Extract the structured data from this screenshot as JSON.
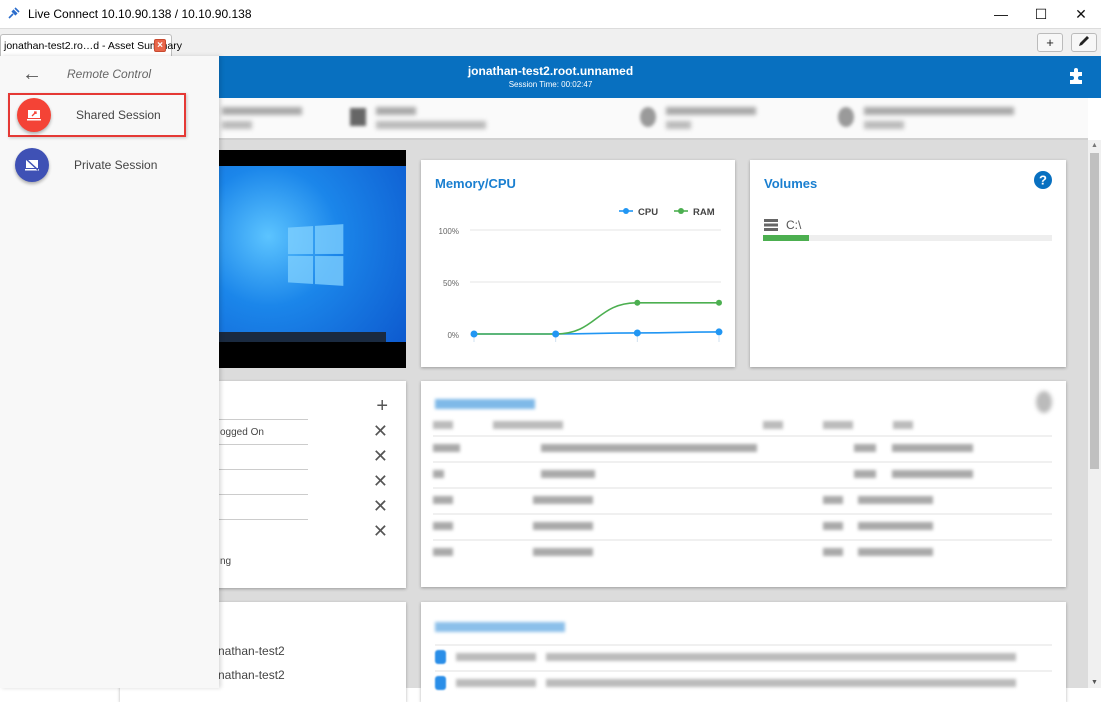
{
  "window": {
    "title": "Live Connect  10.10.90.138 / 10.10.90.138",
    "app_icon": "plug-icon",
    "controls": [
      "minimize",
      "maximize",
      "close"
    ]
  },
  "tabs": [
    {
      "label": "jonathan-test2.ro…d - Asset Summary",
      "close_icon": "close-icon"
    }
  ],
  "tab_tools": {
    "add": "+",
    "edit": "✎"
  },
  "header": {
    "host": "jonathan-test2.root.unnamed",
    "session_time": "Session Time: 00:02:47",
    "plugin_icon": "puzzle-icon"
  },
  "sidebar": {
    "title": "Remote Control",
    "back_icon": "arrow-left-icon",
    "items": [
      {
        "label": "Shared Session",
        "icon": "shared-screen-icon",
        "color": "#f44336",
        "active": true
      },
      {
        "label": "Private Session",
        "icon": "private-screen-icon",
        "color": "#3f51b5",
        "active": false
      }
    ]
  },
  "info_strip": [
    {
      "icon": "computer-icon",
      "line1": "[redacted]",
      "line2": "[redacted]"
    },
    {
      "icon": "windows-icon",
      "line1": "[redacted]",
      "line2": "[redacted]"
    },
    {
      "icon": "globe-icon",
      "line1": "[redacted]",
      "line2": "[redacted]"
    },
    {
      "icon": "cpu-icon",
      "line1": "[redacted]",
      "line2": "[redacted]"
    }
  ],
  "memory_cpu": {
    "title": "Memory/CPU",
    "legend": [
      "CPU",
      "RAM"
    ],
    "colors": {
      "CPU": "#2196f3",
      "RAM": "#4caf50"
    }
  },
  "chart_data": {
    "type": "line",
    "title": "Memory/CPU",
    "x": [
      1,
      2,
      3,
      4
    ],
    "series": [
      {
        "name": "CPU",
        "values": [
          0,
          0,
          1,
          2
        ],
        "color": "#2196f3"
      },
      {
        "name": "RAM",
        "values": [
          0,
          0,
          30,
          30
        ],
        "color": "#4caf50"
      }
    ],
    "yticks": [
      "0%",
      "50%",
      "100%"
    ],
    "ylim": [
      0,
      100
    ],
    "legend": "top-right",
    "grid": true
  },
  "volumes": {
    "title": "Volumes",
    "help_icon": "help-icon",
    "items": [
      {
        "label": "C:\\",
        "icon": "storage-icon",
        "used_fraction": 0.16,
        "color": "#4caf50"
      }
    ]
  },
  "users_card": {
    "add_icon": "plus-icon",
    "rows": [
      {
        "text": "ogged On"
      },
      {
        "text": ""
      },
      {
        "text": ""
      },
      {
        "text": ""
      },
      {
        "text": ""
      }
    ],
    "footer": "ng"
  },
  "processes": {
    "title": "[redacted]",
    "rows": [
      1,
      2,
      3,
      4,
      5
    ]
  },
  "events": {
    "title": "[redacted]",
    "rows": [
      1,
      2
    ]
  },
  "bottom_left_card": {
    "lines": [
      "nathan-test2",
      "nathan-test2"
    ]
  }
}
